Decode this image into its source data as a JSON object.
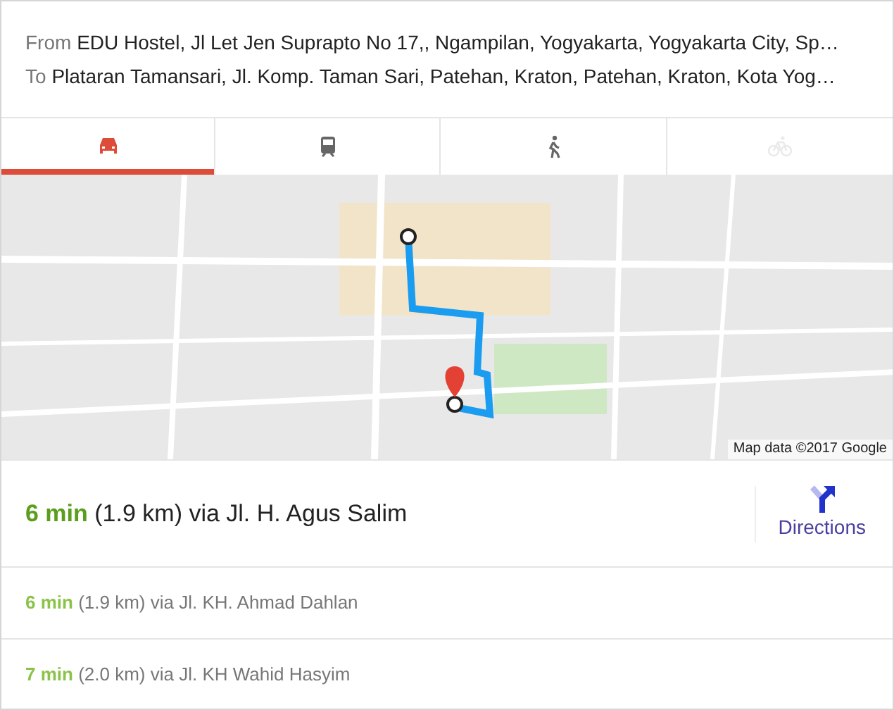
{
  "from": {
    "label": "From",
    "value": "EDU Hostel, Jl Let Jen Suprapto No 17,, Ngampilan, Yogyakarta, Yogyakarta City, Sp…"
  },
  "to": {
    "label": "To",
    "value": "Plataran Tamansari, Jl. Komp. Taman Sari, Patehan, Kraton, Patehan, Kraton, Kota Yog…"
  },
  "tabs": [
    {
      "kind": "car",
      "selected": true,
      "disabled": false
    },
    {
      "kind": "transit",
      "selected": false,
      "disabled": false
    },
    {
      "kind": "walk",
      "selected": false,
      "disabled": false
    },
    {
      "kind": "bike",
      "selected": false,
      "disabled": true
    }
  ],
  "map": {
    "kind": "picture",
    "attribution": "Map data ©2017 Google"
  },
  "routes": [
    {
      "kind": "main",
      "time": "6 min",
      "detail": "(1.9 km) via Jl. H. Agus Salim",
      "action": "Directions"
    },
    {
      "kind": "alternative",
      "time": "6 min",
      "detail": "(1.9 km) via Jl. KH. Ahmad Dahlan"
    },
    {
      "kind": "alternative",
      "time": "7 min",
      "detail": "(2.0 km) via Jl. KH Wahid Hasyim"
    }
  ]
}
